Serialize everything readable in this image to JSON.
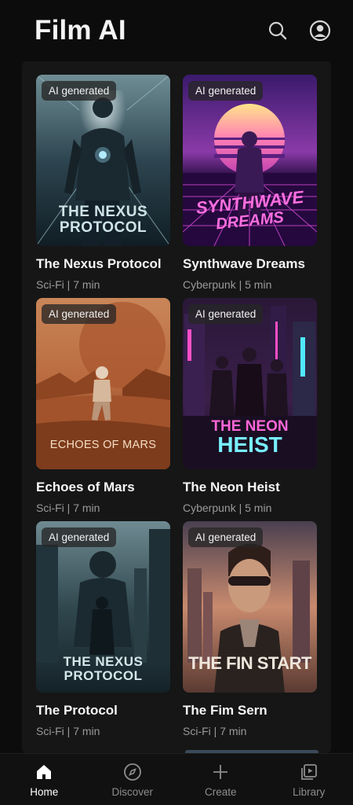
{
  "app": {
    "title": "Film AI"
  },
  "header": {
    "search_icon": "search-icon",
    "profile_icon": "user-circle-icon"
  },
  "films": [
    {
      "badge": "AI generated",
      "poster_text_1": "THE NEXUS",
      "poster_text_2": "PROTOCOL",
      "title": "The Nexus Protocol",
      "meta": "Sci-Fi | 7 min"
    },
    {
      "badge": "AI generated",
      "poster_text_1": "SYNTHWAVE",
      "poster_text_2": "DREAMS",
      "title": "Synthwave Dreams",
      "meta": "Cyberpunk | 5 min"
    },
    {
      "badge": "AI generated",
      "poster_text_1": "ECHOES OF MARS",
      "title": "Echoes of Mars",
      "meta": "Sci-Fi | 7 min"
    },
    {
      "badge": "AI generated",
      "poster_text_1": "THE NEON",
      "poster_text_2": "HEIST",
      "title": "The Neon Heist",
      "meta": "Cyberpunk | 5 min"
    },
    {
      "badge": "AI generated",
      "poster_text_1": "THE NEXUS",
      "poster_text_2": "PROTOCOL",
      "title": "The Protocol",
      "meta": "Sci-Fi | 7 min"
    },
    {
      "badge": "AI generated",
      "poster_text_1": "THE FIN START",
      "title": "The Fim Sern",
      "meta": "Sci-Fi | 7 min"
    }
  ],
  "nav": [
    {
      "label": "Home",
      "icon": "home-icon",
      "active": true
    },
    {
      "label": "Discover",
      "icon": "compass-icon",
      "active": false
    },
    {
      "label": "Create",
      "icon": "plus-icon",
      "active": false
    },
    {
      "label": "Library",
      "icon": "library-icon",
      "active": false
    }
  ],
  "colors": {
    "background": "#0c0c0c",
    "panel": "#161616",
    "meta_text": "#9a9a9a",
    "active_nav": "#ffffff",
    "inactive_nav": "#8e8e8e"
  }
}
